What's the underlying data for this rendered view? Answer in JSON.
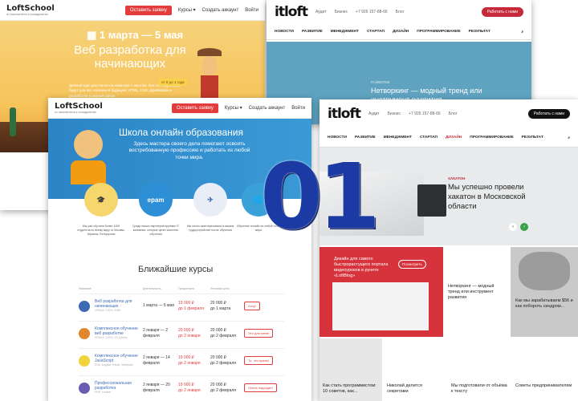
{
  "loftschool_back": {
    "logo": "LoftSchool",
    "logo_sub": "от мыслителя к созидателю",
    "nav_btn": "Оставить заявку",
    "nav_items": [
      "Курсы ▾",
      "Создать аккаунт",
      "Войти"
    ],
    "date": "1 марта — 5 мая",
    "title": "Веб разработка для начинающих",
    "text": "Данный курс рассчитан на новичков с опытом. Все эти подготовки будут для вас полезны в будущем: HTML, CSS, фреймворк и разработки в разной сфере",
    "badge": "от 0 до 1 года"
  },
  "itloft_back": {
    "logo": "itloft",
    "top_items": [
      "Аудит",
      "Бизнес",
      "+7 926 157-88-66",
      "Блог"
    ],
    "cta": "Работать с нами",
    "menu": [
      "НОВОСТИ",
      "РАЗВИТИЕ",
      "МЕНЕДЖМЕНТ",
      "СТАРТАП",
      "ДИЗАЙН",
      "ПРОГРАММИРОВАНИЕ",
      "РЕЗУЛЬТАТ"
    ],
    "hero_tag": "РАЗВИТИЕ",
    "hero_title": "Нетворкинг — модный тренд или инструмент развития"
  },
  "loftschool_front": {
    "logo": "LoftSchool",
    "logo_sub": "от мыслителя к созидателю",
    "nav_btn": "Оставить заявку",
    "nav_items": [
      "Курсы ▾",
      "Создать аккаунт",
      "Войти"
    ],
    "title": "Школа онлайн образования",
    "text": "Здесь мастера своего дела помогают освоить востребованную профессию и работать из любой точки мира.",
    "features": [
      {
        "icon": "🎓",
        "text": "Мы уже обучили более 1000 студентов по всему миру от Москвы, Украины, Белоруссии"
      },
      {
        "icon": "epam",
        "text": "Среди наших партнеров крупные IT компании, которые ценят качество обучения"
      },
      {
        "icon": "✈",
        "text": "Мы лично заинтересованы в вашем трудоустройстве после обучения"
      },
      {
        "icon": "🌐",
        "text": "Обучение онлайн из любой точки мира"
      }
    ],
    "courses_title": "Ближайшие курсы",
    "course_cols": [
      "Название",
      "Длительность",
      "Предоплата",
      "Итоговая цена"
    ],
    "courses": [
      {
        "name": "Веб разработка для начинающих",
        "tags": "HTML5, CSS3, БЭМ",
        "dates": "1 марта — 5 мая",
        "price_old": "19 000 ₽",
        "price_old2": "до 1 февраля",
        "price": "20 000 ₽",
        "price2": "до 1 марта",
        "btn": "Хочу!",
        "color": "#3d6bb3"
      },
      {
        "name": "Комплексное обучение веб разработке",
        "tags": "HTML5, CSS3, JS, jQuery",
        "dates": "2 января — 2 февраля",
        "price_old": "20 000 ₽",
        "price_old2": "до 2 января",
        "price": "20 000 ₽",
        "price2": "до 2 февраля",
        "btn": "Это для меня!",
        "color": "#e2862c"
      },
      {
        "name": "Комплексное обучение JavaScript",
        "tags": "ES6, Angular, React, Webpack",
        "dates": "2 января — 14 февраля",
        "price_old": "19 000 ₽",
        "price_old2": "до 2 января",
        "price": "20 000 ₽",
        "price2": "до 2 февраля",
        "btn": "То, что нужно!",
        "color": "#f0d43c"
      },
      {
        "name": "Профессиональная разработка",
        "tags": "PHP, Laravel",
        "dates": "2 января — 20 февраля",
        "price_old": "19 000 ₽",
        "price_old2": "до 2 января",
        "price": "20 000 ₽",
        "price2": "до 2 февраля",
        "btn": "Очень подходит!",
        "color": "#6a5bb3"
      }
    ]
  },
  "itloft_front": {
    "logo": "itloft",
    "top_items": [
      "Аудит",
      "Бизнес",
      "+7 926 157-88-66",
      "Блог"
    ],
    "cta": "Работать с нами",
    "menu": [
      "НОВОСТИ",
      "РАЗВИТИЕ",
      "МЕНЕДЖМЕНТ",
      "СТАРТАП",
      "ДИЗАЙН",
      "ПРОГРАММИРОВАНИЕ",
      "РЕЗУЛЬТАТ"
    ],
    "hero_tag": "ХАКАТОН",
    "hero_title": "Мы успешно провели хакатон в Московской области",
    "promo_text": "Дизайн для самого быстрорастущего портала видеоуроков в рунете «LoftBlog»",
    "promo_btn": "Посмотреть",
    "card1": "Нетворкинг — модный тренд или инструмент развития",
    "card2": "Как стать программистом: 10 советов, как...",
    "card3": "Как мы зарабатываем $56 и как побороть синдром...",
    "card4": "Николай делится секретами",
    "card5": "Мы подготовили от объёма к тексту",
    "card6": "Советы предпринимателям"
  },
  "overlay_number": "01"
}
